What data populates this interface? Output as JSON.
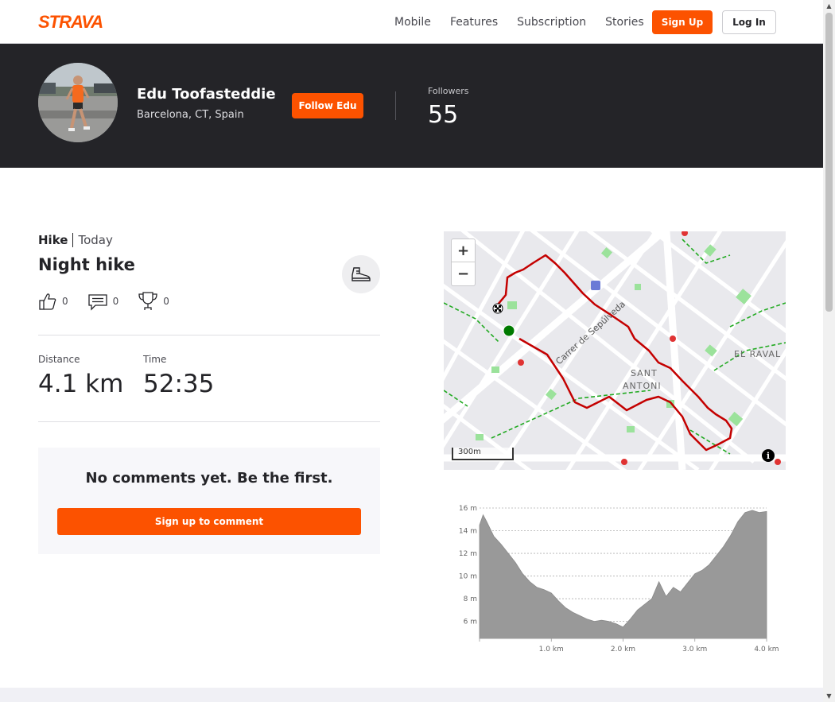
{
  "nav": {
    "logo_text": "STRAVA",
    "links": [
      "Mobile",
      "Features",
      "Subscription",
      "Stories"
    ],
    "signup_label": "Sign Up",
    "login_label": "Log In"
  },
  "athlete": {
    "name": "Edu Toofasteddie",
    "location": "Barcelona, CT, Spain",
    "follow_label": "Follow Edu",
    "followers_label": "Followers",
    "followers_count": "55"
  },
  "activity": {
    "type": "Hike",
    "date": "Today",
    "title": "Night hike",
    "kudos": "0",
    "comments": "0",
    "achievements": "0",
    "distance_label": "Distance",
    "distance_value": "4.1 km",
    "time_label": "Time",
    "time_value": "52:35"
  },
  "comments_box": {
    "empty_text": "No comments yet. Be the first.",
    "button_label": "Sign up to comment"
  },
  "map": {
    "zoom_in": "+",
    "zoom_out": "−",
    "scale_label": "300m",
    "street_label": "Carrer de Sepúlveda",
    "district_1": "SANT",
    "district_2": "ANTONI",
    "district_3": "EL RAVAL",
    "info": "i",
    "route_color": "#c40000",
    "start_color": "#007a00"
  },
  "chart_data": {
    "type": "area",
    "x": [
      0.0,
      0.05,
      0.1,
      0.2,
      0.3,
      0.4,
      0.5,
      0.6,
      0.7,
      0.8,
      0.9,
      1.0,
      1.1,
      1.2,
      1.3,
      1.4,
      1.5,
      1.6,
      1.7,
      1.8,
      1.9,
      2.0,
      2.1,
      2.2,
      2.3,
      2.4,
      2.5,
      2.6,
      2.7,
      2.8,
      2.9,
      3.0,
      3.1,
      3.2,
      3.3,
      3.4,
      3.5,
      3.6,
      3.7,
      3.8,
      3.9,
      4.0
    ],
    "values": [
      14.5,
      15.4,
      14.8,
      13.5,
      12.8,
      12.0,
      11.2,
      10.2,
      9.5,
      9.0,
      8.8,
      8.5,
      7.8,
      7.2,
      6.8,
      6.5,
      6.2,
      6.0,
      6.1,
      6.0,
      5.8,
      5.5,
      6.2,
      7.0,
      7.5,
      8.0,
      9.5,
      8.2,
      9.0,
      8.6,
      9.4,
      10.2,
      10.5,
      11.0,
      11.8,
      12.6,
      13.6,
      14.8,
      15.6,
      15.8,
      15.6,
      15.7
    ],
    "xlim": [
      0,
      4.0
    ],
    "ylim": [
      4.5,
      16
    ],
    "xticks": [
      "1.0 km",
      "2.0 km",
      "3.0 km",
      "4.0 km"
    ],
    "xtick_values": [
      1.0,
      2.0,
      3.0,
      4.0
    ],
    "yticks": [
      "6 m",
      "8 m",
      "10 m",
      "12 m",
      "14 m",
      "16 m"
    ],
    "ytick_values": [
      6,
      8,
      10,
      12,
      14,
      16
    ],
    "grid": true,
    "fill": "#999999"
  }
}
